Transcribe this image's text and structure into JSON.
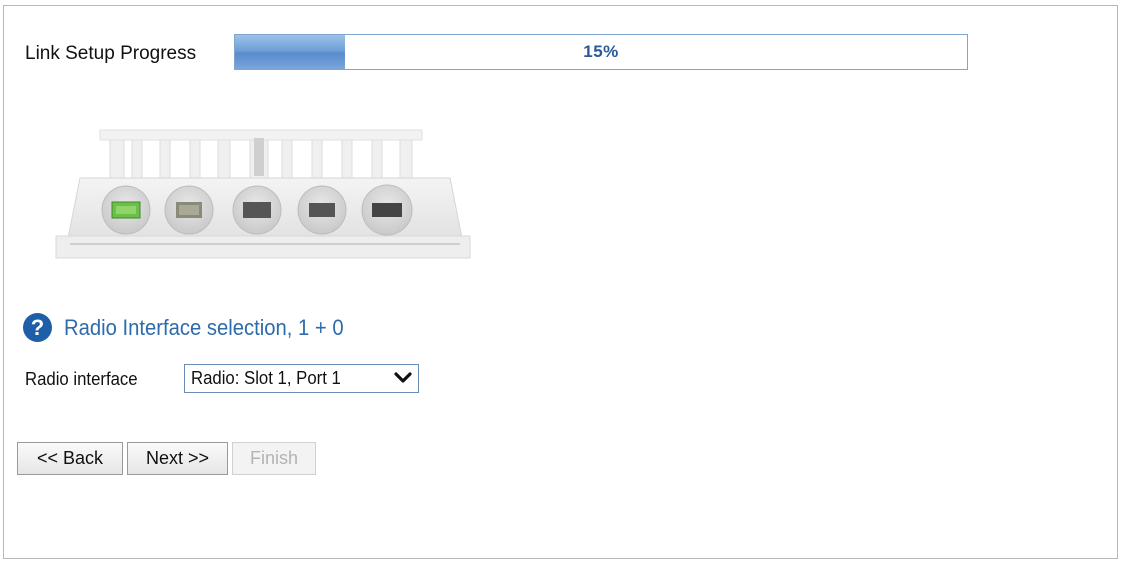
{
  "progress": {
    "label": "Link Setup Progress",
    "percent_text": "15%",
    "value": 0.15,
    "fill_color": "#6f9fd6",
    "text_color": "#2a5a9a"
  },
  "device_image": {
    "icon": "radio-unit-device-illustration"
  },
  "section": {
    "help_icon": "?",
    "title": "Radio Interface selection, 1 + 0"
  },
  "radio_interface": {
    "label": "Radio interface",
    "selected": "Radio: Slot 1, Port 1"
  },
  "buttons": {
    "back": "<< Back",
    "next": "Next >>",
    "finish": "Finish"
  }
}
